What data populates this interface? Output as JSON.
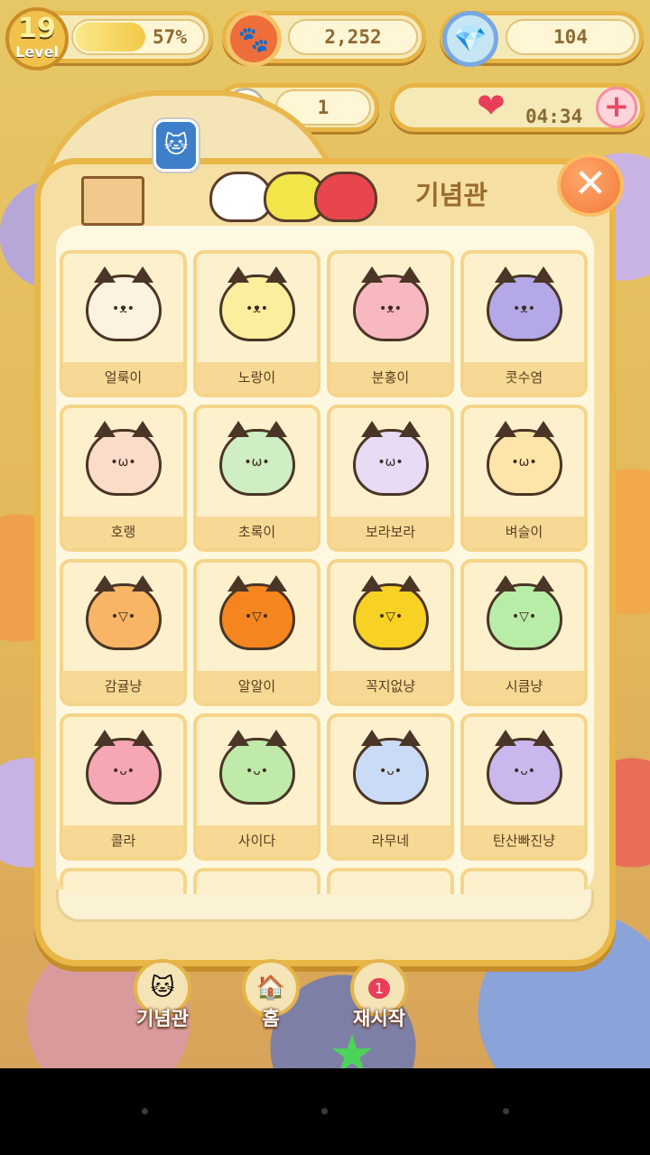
{
  "hud": {
    "level_number": "19",
    "level_word": "Level",
    "xp_percent": 57,
    "xp_text": "57%",
    "paw_coins": "2,252",
    "gems": "104",
    "tickets": "1",
    "timer": "04:34"
  },
  "icons": {
    "paw": "🐾",
    "gem": "💎",
    "ticket": "▭",
    "heart": "❤",
    "plus": "+",
    "close": "✕",
    "star": "★"
  },
  "panel": {
    "title": "기념관"
  },
  "cats": [
    {
      "name": "얼룩이",
      "color": "#fbf2df",
      "face": "•ᴥ•"
    },
    {
      "name": "노랑이",
      "color": "#fbef9d",
      "face": "•ᴥ•"
    },
    {
      "name": "분홍이",
      "color": "#f7b8bf",
      "face": "•ᴥ•"
    },
    {
      "name": "콧수염",
      "color": "#b4a8e8",
      "face": "•ᴥ•"
    },
    {
      "name": "호랭",
      "color": "#fbdcc8",
      "face": "•ω•"
    },
    {
      "name": "초록이",
      "color": "#cfeec3",
      "face": "•ω•"
    },
    {
      "name": "보라보라",
      "color": "#e7dbf6",
      "face": "•ω•"
    },
    {
      "name": "벼슬이",
      "color": "#fde5a9",
      "face": "•ω•"
    },
    {
      "name": "감귤냥",
      "color": "#f8b565",
      "face": "•▽•"
    },
    {
      "name": "알알이",
      "color": "#f4851f",
      "face": "•▽•"
    },
    {
      "name": "꼭지없냥",
      "color": "#f7d123",
      "face": "•▽•"
    },
    {
      "name": "시큼냥",
      "color": "#b8eda8",
      "face": "•▽•"
    },
    {
      "name": "콜라",
      "color": "#f7a6b4",
      "face": "•ᴗ•"
    },
    {
      "name": "사이다",
      "color": "#bfeaa9",
      "face": "•ᴗ•"
    },
    {
      "name": "라무네",
      "color": "#c9dbf5",
      "face": "•ᴗ•"
    },
    {
      "name": "탄산빠진냥",
      "color": "#c9b7ee",
      "face": "•ᴗ•"
    }
  ],
  "menu": {
    "collection_label": "기념관",
    "home_label": "홈",
    "restart_label": "재시작",
    "restart_badge": "1"
  }
}
